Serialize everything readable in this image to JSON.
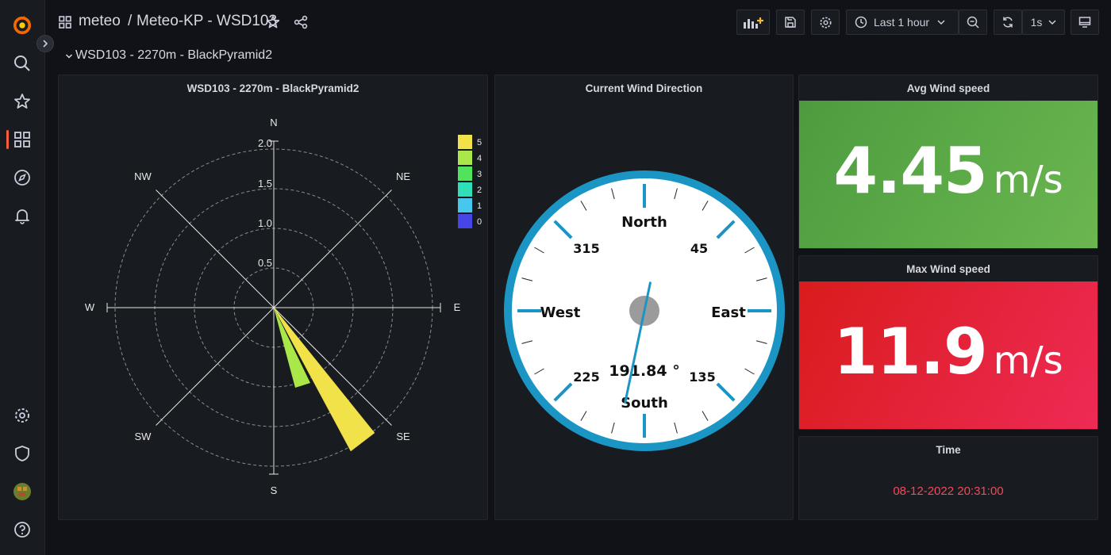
{
  "breadcrumb": {
    "folder": "meteo",
    "separator": "/",
    "dashboard": "Meteo-KP - WSD103"
  },
  "time_picker": {
    "label": "Last 1 hour"
  },
  "refresh": {
    "interval": "1s"
  },
  "row": {
    "title": "WSD103 - 2270m - BlackPyramid2"
  },
  "windrose": {
    "title": "WSD103 - 2270m - BlackPyramid2",
    "directions": [
      "N",
      "NE",
      "E",
      "SE",
      "S",
      "SW",
      "W",
      "NW"
    ],
    "radial_ticks": [
      "0.5",
      "1.0",
      "1.5",
      "2.0"
    ],
    "legend": [
      {
        "label": "5",
        "color": "#f2e24a"
      },
      {
        "label": "4",
        "color": "#a9e848"
      },
      {
        "label": "3",
        "color": "#4fe45a"
      },
      {
        "label": "2",
        "color": "#2de0b8"
      },
      {
        "label": "1",
        "color": "#47c6ee"
      },
      {
        "label": "0",
        "color": "#4646e8"
      }
    ]
  },
  "compass": {
    "title": "Current Wind Direction",
    "cardinals": {
      "north": "North",
      "east": "East",
      "south": "South",
      "west": "West"
    },
    "degree_labels": {
      "d45": "45",
      "d135": "135",
      "d225": "225",
      "d315": "315"
    },
    "value_text": "191.84 °",
    "value": 191.84
  },
  "avg_speed": {
    "title": "Avg Wind speed",
    "value": "4.45",
    "unit": "m/s",
    "color": "#56a64b"
  },
  "max_speed": {
    "title": "Max Wind speed",
    "value": "11.9",
    "unit": "m/s",
    "color": "#e02f44"
  },
  "time_panel": {
    "title": "Time",
    "value": "08-12-2022 20:31:00",
    "color": "#f2495c"
  }
}
